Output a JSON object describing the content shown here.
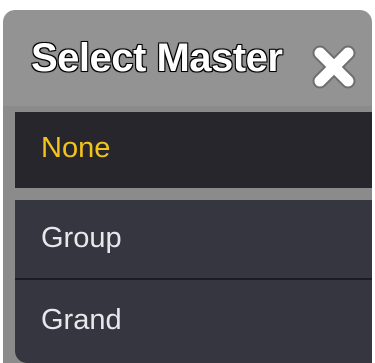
{
  "dialog": {
    "title": "Select Master",
    "close_icon": "close-x-icon",
    "options": [
      {
        "label": "None",
        "selected": true
      },
      {
        "label": "Group",
        "selected": false
      },
      {
        "label": "Grand",
        "selected": false
      }
    ]
  },
  "colors": {
    "titlebar": "#939393",
    "selected_text": "#f3c21b",
    "item_background": "#363640",
    "selected_background": "#26262c",
    "item_text": "#e8e8ec"
  }
}
